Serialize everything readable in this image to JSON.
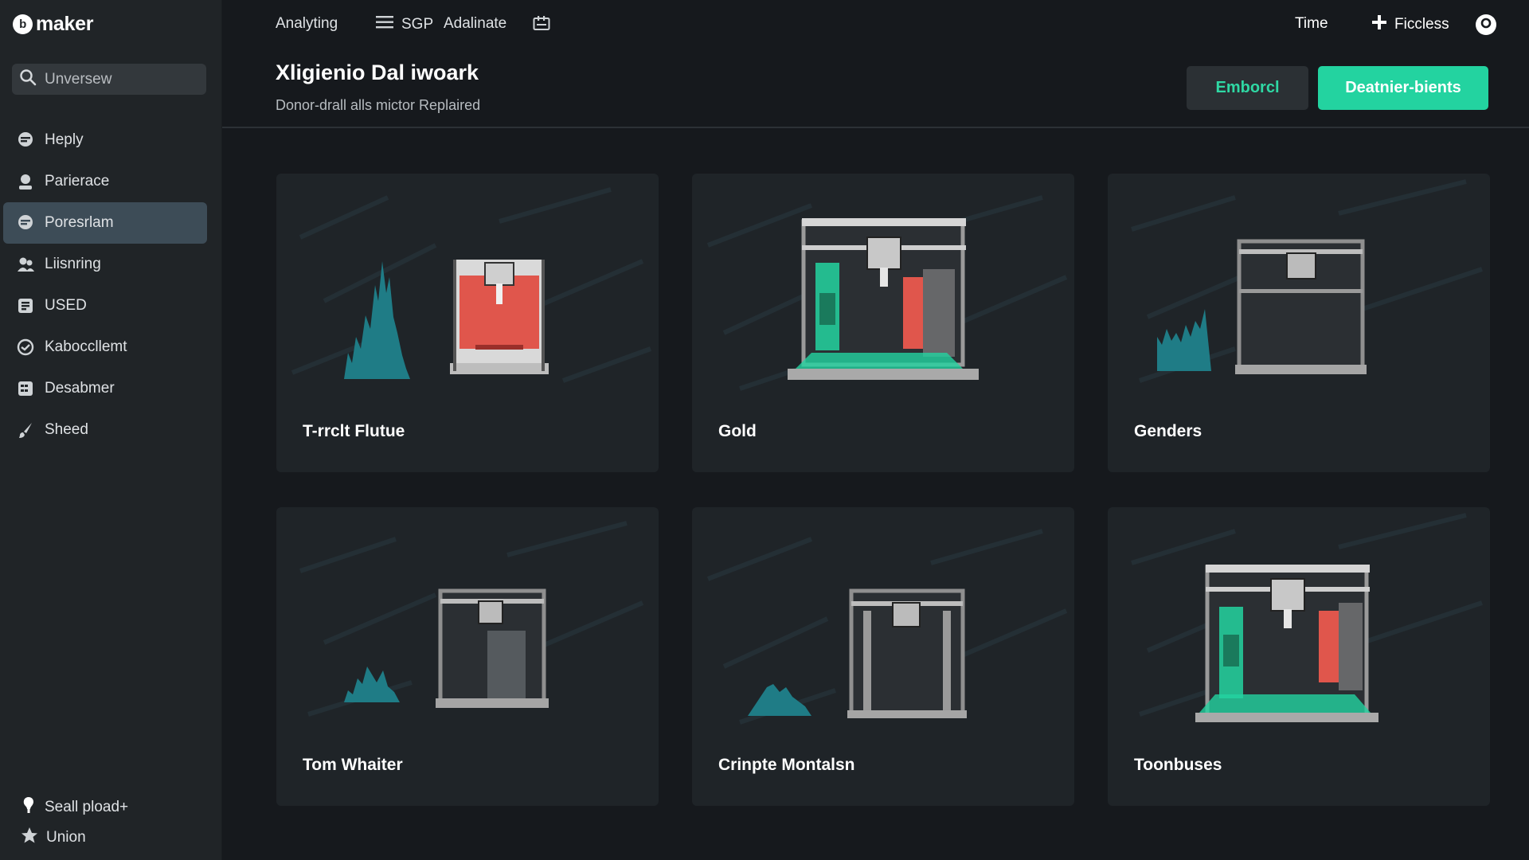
{
  "app": {
    "logo_text": "maker",
    "logo_mark": "b"
  },
  "sidebar": {
    "search_placeholder": "Unversew",
    "items": [
      {
        "label": "Heply",
        "icon": "chat-icon",
        "active": false
      },
      {
        "label": "Parierace",
        "icon": "user-icon",
        "active": false
      },
      {
        "label": "Poresrlam",
        "icon": "chat-icon",
        "active": true
      },
      {
        "label": "Liisnring",
        "icon": "group-icon",
        "active": false
      },
      {
        "label": "USED",
        "icon": "box-icon",
        "active": false
      },
      {
        "label": "Kaboccllemt",
        "icon": "circle-check-icon",
        "active": false
      },
      {
        "label": "Desabmer",
        "icon": "grid-icon",
        "active": false
      },
      {
        "label": "Sheed",
        "icon": "brush-icon",
        "active": false
      }
    ],
    "footer": [
      {
        "label": "Seall pload+",
        "icon": "pin-icon"
      },
      {
        "label": "Union",
        "icon": "star-icon"
      }
    ]
  },
  "topbar": {
    "links": [
      "Analyting",
      "SGP",
      "Adalinate"
    ],
    "time_label": "Time",
    "add_label": "Ficcless"
  },
  "header": {
    "title": "Xligienio Dal iwoark",
    "subtitle": "Donor-drall alls mictor Replaired",
    "secondary_button": "Emborcl",
    "primary_button": "Deatnier-bients"
  },
  "cards": [
    {
      "title": "T-rrclt Flutue",
      "style": "red-chamber-with-chart"
    },
    {
      "title": "Gold",
      "style": "green-red-printer"
    },
    {
      "title": "Genders",
      "style": "frame-with-chart"
    },
    {
      "title": "Tom Whaiter",
      "style": "frame-with-small-chart"
    },
    {
      "title": "Crinpte Montalsn",
      "style": "frame-with-small-chart"
    },
    {
      "title": "Toonbuses",
      "style": "green-red-printer"
    }
  ],
  "colors": {
    "accent": "#23d3a0",
    "accent_text": "#2fd8a4",
    "active_nav": "#3d4c57",
    "chart_teal": "#1f7c86",
    "chamber_red": "#e0564c"
  }
}
